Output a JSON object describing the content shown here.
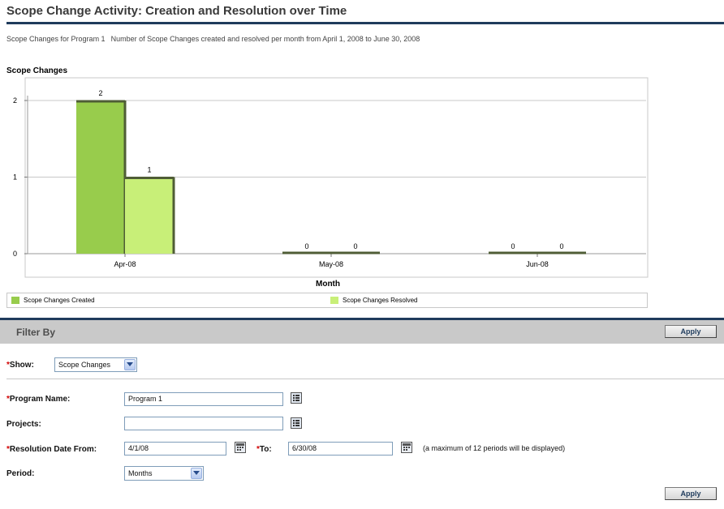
{
  "page": {
    "title": "Scope Change Activity: Creation and Resolution over Time",
    "subtitle_program": "Scope Changes for Program 1",
    "subtitle_desc": "Number of Scope Changes created and resolved per month from April 1, 2008 to June 30, 2008"
  },
  "chart_data": {
    "type": "bar",
    "ylabel": "Scope Changes",
    "xlabel": "Month",
    "categories": [
      "Apr-08",
      "May-08",
      "Jun-08"
    ],
    "series": [
      {
        "name": "Scope Changes Created",
        "values": [
          2,
          0,
          0
        ],
        "color": "#98cc4c"
      },
      {
        "name": "Scope Changes Resolved",
        "values": [
          1,
          0,
          0
        ],
        "color": "#c8ef78"
      }
    ],
    "ylim": [
      0,
      2
    ],
    "yticks": [
      0,
      1,
      2
    ],
    "grid": true,
    "legend": "bottom"
  },
  "filter": {
    "title": "Filter By",
    "apply_label": "Apply",
    "show_label": "Show:",
    "show_value": "Scope Changes",
    "program_label": "Program Name:",
    "program_value": "Program 1",
    "projects_label": "Projects:",
    "projects_value": "",
    "res_from_label": "Resolution Date From:",
    "res_from_value": "4/1/08",
    "to_label": "To:",
    "to_value": "6/30/08",
    "note": "(a maximum of 12 periods will be displayed)",
    "period_label": "Period:",
    "period_value": "Months",
    "required_mark": "*"
  },
  "colors": {
    "header_rule": "#1f3b5c",
    "filter_bar": "#c9c9c9",
    "required": "#d10000"
  }
}
